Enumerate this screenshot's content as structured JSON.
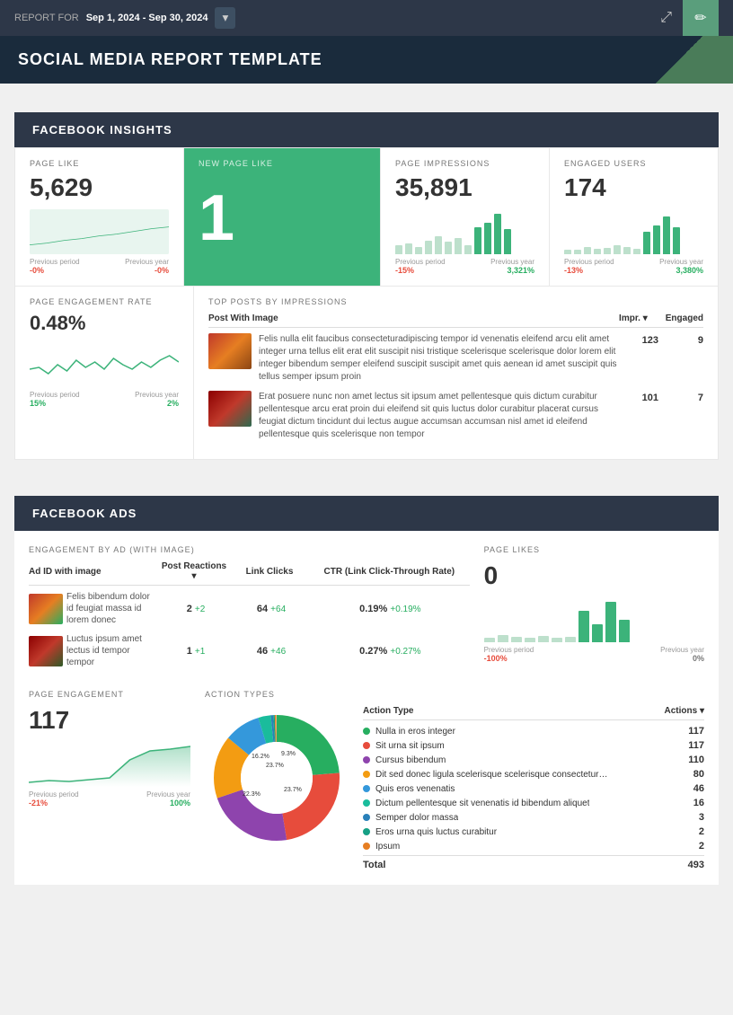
{
  "header": {
    "report_label": "REPORT FOR",
    "date_range": "Sep 1, 2024 - Sep 30, 2024",
    "share_icon": "⤢",
    "edit_icon": "✏"
  },
  "title": "SOCIAL MEDIA REPORT TEMPLATE",
  "facebook_insights": {
    "section_label": "FACEBOOK INSIGHTS",
    "page_like": {
      "label": "PAGE LIKE",
      "value": "5,629",
      "prev_period_label": "Previous period",
      "prev_year_label": "Previous year",
      "prev_period_delta": "-0%",
      "prev_year_delta": "-0%"
    },
    "new_page_like": {
      "label": "NEW PAGE LIKE",
      "value": "1"
    },
    "page_impressions": {
      "label": "PAGE IMPRESSIONS",
      "value": "35,891",
      "prev_period_label": "Previous period",
      "prev_year_label": "Previous year",
      "prev_period_delta": "-15%",
      "prev_year_delta": "3,321%"
    },
    "engaged_users": {
      "label": "ENGAGED USERS",
      "value": "174",
      "prev_period_label": "Previous period",
      "prev_year_label": "Previous year",
      "prev_period_delta": "-13%",
      "prev_year_delta": "3,380%"
    },
    "page_engagement_rate": {
      "label": "PAGE ENGAGEMENT RATE",
      "value": "0.48%",
      "prev_period_label": "Previous period",
      "prev_year_label": "Previous year",
      "prev_period_delta": "15%",
      "prev_year_delta": "2%"
    },
    "top_posts": {
      "label": "TOP POSTS BY IMPRESSIONS",
      "col_post": "Post With Image",
      "col_impr": "Impr.",
      "col_engaged": "Engaged",
      "posts": [
        {
          "text": "Felis nulla elit faucibus consecteturadipiscing tempor id venenatis eleifend arcu elit amet integer urna tellus elit erat elit suscipit nisi tristique scelerisque scelerisque dolor lorem elit integer bibendum semper eleifend suscipit suscipit amet quis aenean id amet suscipit quis tellus semper ipsum proin",
          "impr": "123",
          "engaged": "9",
          "img_type": "autumn"
        },
        {
          "text": "Erat posuere nunc non amet lectus sit ipsum amet pellentesque quis dictum curabitur pellentesque arcu erat proin dui eleifend sit quis luctus dolor curabitur placerat cursus feugiat dictum tincidunt dui lectus augue accumsan accumsan nisl amet id eleifend pellentesque quis scelerisque non tempor",
          "impr": "101",
          "engaged": "7",
          "img_type": "red"
        }
      ]
    }
  },
  "facebook_ads": {
    "section_label": "FACEBOOK ADS",
    "engagement_label": "ENGAGEMENT BY AD (WITH IMAGE)",
    "col_ad": "Ad ID with image",
    "col_reactions": "Post Reactions",
    "col_clicks": "Link Clicks",
    "col_ctr": "CTR (Link Click-Through Rate)",
    "ads": [
      {
        "name": "Felis bibendum dolor id feugiat massa id lorem donec",
        "reactions_val": "2",
        "reactions_delta": "+2",
        "clicks_val": "64",
        "clicks_delta": "+64",
        "ctr_val": "0.19%",
        "ctr_delta": "+0.19%",
        "img_type": "1"
      },
      {
        "name": "Luctus ipsum amet lectus id tempor tempor",
        "reactions_val": "1",
        "reactions_delta": "+1",
        "clicks_val": "46",
        "clicks_delta": "+46",
        "ctr_val": "0.27%",
        "ctr_delta": "+0.27%",
        "img_type": "2"
      }
    ],
    "page_likes": {
      "label": "PAGE LIKES",
      "value": "0",
      "prev_period_label": "Previous period",
      "prev_year_label": "Previous year",
      "prev_period_delta": "-100%",
      "prev_year_delta": "0%"
    },
    "page_engagement": {
      "label": "PAGE ENGAGEMENT",
      "value": "117",
      "prev_period_label": "Previous period",
      "prev_year_label": "Previous year",
      "prev_period_delta": "-21%",
      "prev_year_delta": "100%"
    },
    "action_types": {
      "label": "ACTION TYPES",
      "col_type": "Action Type",
      "col_actions": "Actions",
      "rows": [
        {
          "label": "Nulla in eros integer",
          "value": "117",
          "color": "#27ae60"
        },
        {
          "label": "Sit urna sit ipsum",
          "value": "117",
          "color": "#e74c3c"
        },
        {
          "label": "Cursus bibendum",
          "value": "110",
          "color": "#8e44ad"
        },
        {
          "label": "Dit sed donec ligula scelerisque scelerisque consecteturadipisci...",
          "value": "80",
          "color": "#f39c12"
        },
        {
          "label": "Quis eros venenatis",
          "value": "46",
          "color": "#3498db"
        },
        {
          "label": "Dictum pellentesque sit venenatis id bibendum aliquet",
          "value": "16",
          "color": "#1abc9c"
        },
        {
          "label": "Semper dolor massa",
          "value": "3",
          "color": "#2980b9"
        },
        {
          "label": "Eros urna quis luctus curabitur",
          "value": "2",
          "color": "#16a085"
        },
        {
          "label": "Ipsum",
          "value": "2",
          "color": "#e67e22"
        }
      ],
      "total_label": "Total",
      "total_value": "493",
      "donut_segments": [
        {
          "label": "23.7%",
          "color": "#27ae60",
          "percent": 23.7
        },
        {
          "label": "23.7%",
          "color": "#e74c3c",
          "percent": 23.7
        },
        {
          "label": "22.3%",
          "color": "#8e44ad",
          "percent": 22.3
        },
        {
          "label": "16.2%",
          "color": "#f39c12",
          "percent": 16.2
        },
        {
          "label": "9.3%",
          "color": "#3498db",
          "percent": 9.3
        },
        {
          "label": "3.2%",
          "color": "#1abc9c",
          "percent": 3.2
        },
        {
          "label": "0.6%",
          "color": "#2980b9",
          "percent": 0.6
        },
        {
          "label": "0.4%",
          "color": "#16a085",
          "percent": 0.4
        },
        {
          "label": "0.4%",
          "color": "#e67e22",
          "percent": 0.4
        }
      ]
    }
  }
}
